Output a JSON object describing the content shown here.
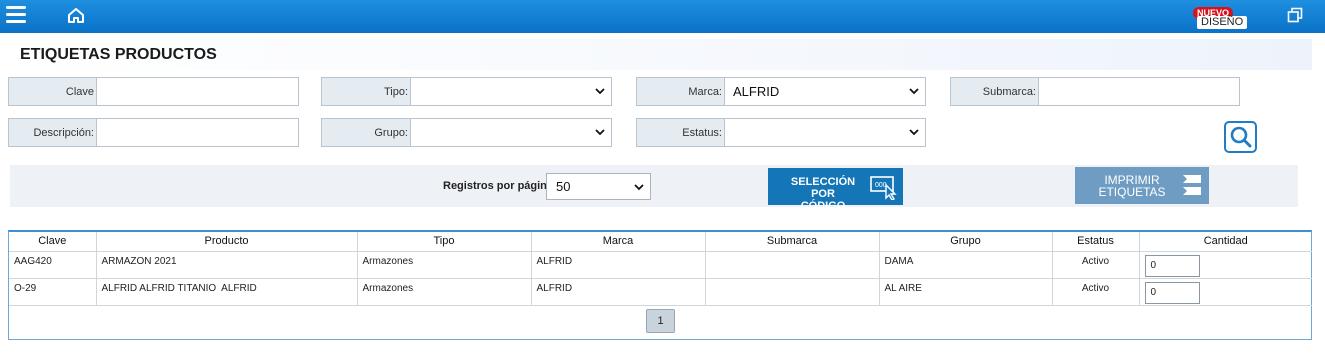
{
  "topbar": {
    "badge_new": "NUEVO",
    "design_label": "DISEÑO",
    "icons": [
      "menu-icon",
      "home-icon",
      "restore-window-icon"
    ],
    "color": "#1583d6"
  },
  "page": {
    "title": "ETIQUETAS PRODUCTOS"
  },
  "filters": {
    "clave": {
      "label": "Clave",
      "value": ""
    },
    "tipo": {
      "label": "Tipo:",
      "value": ""
    },
    "marca": {
      "label": "Marca:",
      "value": "ALFRID"
    },
    "submarca": {
      "label": "Submarca:",
      "value": ""
    },
    "descripcion": {
      "label": "Descripción:",
      "value": ""
    },
    "grupo": {
      "label": "Grupo:",
      "value": ""
    },
    "estatus": {
      "label": "Estatus:",
      "value": ""
    }
  },
  "toolbar": {
    "rpp_label": "Registros por página:",
    "rpp_value": "50",
    "select_by_code": [
      "SELECCIÓN",
      "POR CÓDIGO"
    ],
    "print_labels": [
      "IMPRIMIR",
      "ETIQUETAS"
    ],
    "select_color": "#1476b6",
    "print_color": "#6e9cc3"
  },
  "table": {
    "columns": [
      "Clave",
      "Producto",
      "Tipo",
      "Marca",
      "Submarca",
      "Grupo",
      "Estatus",
      "Cantidad"
    ],
    "rows": [
      {
        "clave": "AAG420",
        "producto": "ARMAZON 2021",
        "tipo": "Armazones",
        "marca": "ALFRID",
        "submarca": "",
        "grupo": "DAMA",
        "estatus": "Activo",
        "cantidad": "0"
      },
      {
        "clave": "O-29",
        "producto": "ALFRID ALFRID TITANIO  ALFRID",
        "tipo": "Armazones",
        "marca": "ALFRID",
        "submarca": "",
        "grupo": "AL AIRE",
        "estatus": "Activo",
        "cantidad": "0"
      }
    ]
  },
  "pagination": {
    "current": "1"
  }
}
